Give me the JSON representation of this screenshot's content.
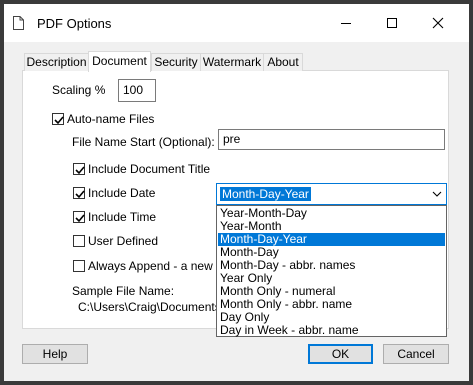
{
  "window": {
    "title": "PDF Options",
    "icon": "document-icon"
  },
  "tabs": [
    {
      "label": "Description",
      "active": false
    },
    {
      "label": "Document",
      "active": true
    },
    {
      "label": "Security",
      "active": false
    },
    {
      "label": "Watermark",
      "active": false
    },
    {
      "label": "About",
      "active": false
    }
  ],
  "scaling": {
    "label": "Scaling %",
    "value": "100"
  },
  "auto_name": {
    "label": "Auto-name Files",
    "checked": true
  },
  "file_start": {
    "label": "File Name Start (Optional):",
    "value": "pre"
  },
  "options": [
    {
      "label": "Include Document Title",
      "checked": true
    },
    {
      "label": "Include Date",
      "checked": true
    },
    {
      "label": "Include Time",
      "checked": true
    },
    {
      "label": "User Defined",
      "checked": false
    },
    {
      "label": "Always Append - a new file",
      "checked": false
    }
  ],
  "sample": {
    "label": "Sample File Name:",
    "value": "C:\\Users\\Craig\\Documents\\i"
  },
  "date_format": {
    "selected": "Month-Day-Year",
    "options": [
      "Year-Month-Day",
      "Year-Month",
      "Month-Day-Year",
      "Month-Day",
      "Month-Day - abbr. names",
      "Year Only",
      "Month Only - numeral",
      "Month Only - abbr. name",
      "Day Only",
      "Day in Week - abbr. name"
    ],
    "highlighted_index": 2
  },
  "buttons": {
    "help": "Help",
    "ok": "OK",
    "cancel": "Cancel"
  },
  "colors": {
    "accent": "#0078d7",
    "panel": "#ffffff",
    "window": "#f0f0f0"
  }
}
